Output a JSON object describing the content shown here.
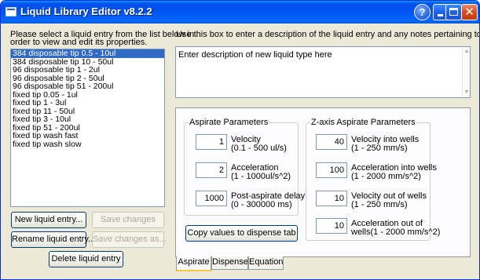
{
  "window": {
    "title": "Liquid Library Editor v8.2.2"
  },
  "titlebar": {
    "help_glyph": "?",
    "close_glyph": "✕"
  },
  "left": {
    "instructions_line1": "Please select a liquid entry from the list below in",
    "instructions_line2": "order to view and edit its properties.",
    "liquids": [
      "384 disposable tip 0.5 - 10ul",
      "384 disposable tip 10 - 50ul",
      "96 disposable tip 1 - 2ul",
      "96 disposable tip 2 - 50ul",
      "96 disposable tip 51 - 200ul",
      "fixed tip 0.05 - 1ul",
      "fixed tip 1 - 3ul",
      "fixed tip 11 - 50ul",
      "fixed tip 3 - 10ul",
      "fixed tip 51 - 200ul",
      "fixed tip wash fast",
      "fixed tip wash slow"
    ],
    "selected_index": 0,
    "buttons": {
      "new_entry": "New liquid entry...",
      "save_changes": "Save changes",
      "rename_entry": "Rename liquid entry...",
      "save_changes_as": "Save changes as...",
      "delete_entry": "Delete liquid entry"
    }
  },
  "right": {
    "description_hint": "Use this box to enter a description of the liquid entry and any notes pertaining to its use.",
    "description_value": "Enter description of new liquid type here",
    "aspirate": {
      "title": "Aspirate Parameters",
      "fields": [
        {
          "value": "1",
          "label1": "Velocity",
          "label2": "(0.1 - 500 ul/s)"
        },
        {
          "value": "2",
          "label1": "Acceleration",
          "label2": "(1 - 1000ul/s^2)"
        },
        {
          "value": "1000",
          "label1": "Post-aspirate delay",
          "label2": "(0 - 300000 ms)"
        }
      ]
    },
    "zaxis": {
      "title": "Z-axis Aspirate Parameters",
      "fields": [
        {
          "value": "40",
          "label1": "Velocity into wells",
          "label2": "(1 - 250 mm/s)"
        },
        {
          "value": "100",
          "label1": "Acceleration into wells",
          "label2": "(1 - 2000 mm/s^2)"
        },
        {
          "value": "10",
          "label1": "Velocity out of wells",
          "label2": "(1 - 250 mm/s)"
        },
        {
          "value": "10",
          "label1": "Acceleration out of",
          "label2": "wells(1 - 2000 mm/s^2)"
        }
      ]
    },
    "copy_button": "Copy values to dispense tab",
    "tabs": [
      "Aspirate",
      "Dispense",
      "Equation"
    ],
    "active_tab": "Aspirate"
  },
  "colors": {
    "titlebar": "#0054e3",
    "selection": "#316ac5",
    "face": "#ece9d8",
    "tab_highlight": "#ffc83c"
  }
}
